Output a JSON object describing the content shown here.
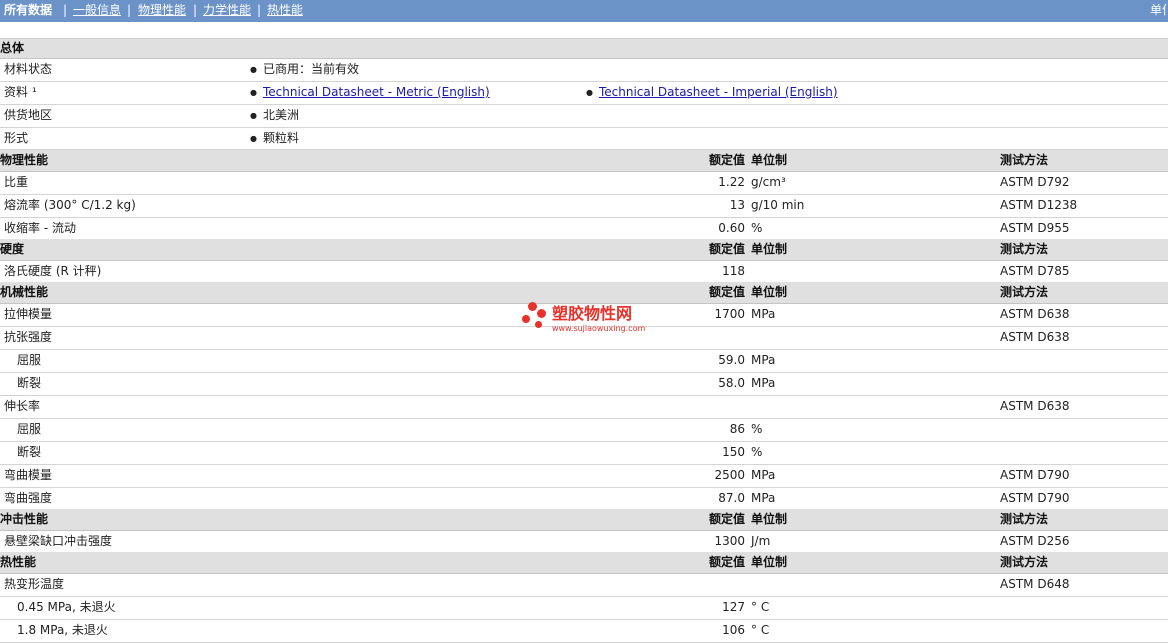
{
  "nav": {
    "all": "所有数据",
    "links": [
      "一般信息",
      "物理性能",
      "力学性能",
      "热性能"
    ],
    "unit": "单位"
  },
  "general": {
    "title": "总体",
    "status_label": "材料状态",
    "status_value": "已商用：当前有效",
    "docs_label": "资料 ¹",
    "doc_metric": "Technical Datasheet - Metric (English)",
    "doc_imperial": "Technical Datasheet - Imperial (English)",
    "region_label": "供货地区",
    "region_value": "北美洲",
    "form_label": "形式",
    "form_value": "颗粒料"
  },
  "columns": {
    "value": "额定值",
    "unit": "单位制",
    "test": "测试方法"
  },
  "physical": {
    "title": "物理性能",
    "rows": [
      {
        "name": "比重",
        "value": "1.22",
        "unit": "g/cm³",
        "test": "ASTM D792"
      },
      {
        "name": "熔流率 (300° C/1.2 kg)",
        "value": "13",
        "unit": "g/10 min",
        "test": "ASTM D1238"
      },
      {
        "name": "收缩率 - 流动",
        "value": "0.60",
        "unit": "%",
        "test": "ASTM D955"
      }
    ]
  },
  "hardness": {
    "title": "硬度",
    "rows": [
      {
        "name": "洛氏硬度 (R 计秤)",
        "value": "118",
        "unit": "",
        "test": "ASTM D785"
      }
    ]
  },
  "mechanical": {
    "title": "机械性能",
    "rows": [
      {
        "name": "拉伸模量",
        "value": "1700",
        "unit": "MPa",
        "test": "ASTM D638"
      },
      {
        "name": "抗张强度",
        "value": "",
        "unit": "",
        "test": "ASTM D638"
      },
      {
        "name": "屈服",
        "value": "59.0",
        "unit": "MPa",
        "test": ""
      },
      {
        "name": "断裂",
        "value": "58.0",
        "unit": "MPa",
        "test": ""
      },
      {
        "name": "伸长率",
        "value": "",
        "unit": "",
        "test": "ASTM D638"
      },
      {
        "name": "屈服",
        "value": "86",
        "unit": "%",
        "test": ""
      },
      {
        "name": "断裂",
        "value": "150",
        "unit": "%",
        "test": ""
      },
      {
        "name": "弯曲模量",
        "value": "2500",
        "unit": "MPa",
        "test": "ASTM D790"
      },
      {
        "name": "弯曲强度",
        "value": "87.0",
        "unit": "MPa",
        "test": "ASTM D790"
      }
    ]
  },
  "impact": {
    "title": "冲击性能",
    "rows": [
      {
        "name": "悬壁梁缺口冲击强度",
        "value": "1300",
        "unit": "J/m",
        "test": "ASTM D256"
      }
    ]
  },
  "thermal": {
    "title": "热性能",
    "rows": [
      {
        "name": "热变形温度",
        "value": "",
        "unit": "",
        "test": "ASTM D648"
      },
      {
        "name": "0.45 MPa, 未退火",
        "value": "127",
        "unit": "° C",
        "test": ""
      },
      {
        "name": "1.8 MPa, 未退火",
        "value": "106",
        "unit": "° C",
        "test": ""
      }
    ]
  },
  "watermark": {
    "title": "塑胶物性网",
    "url": "www.sujiaowuxing.com",
    "color": "#e8312a"
  }
}
